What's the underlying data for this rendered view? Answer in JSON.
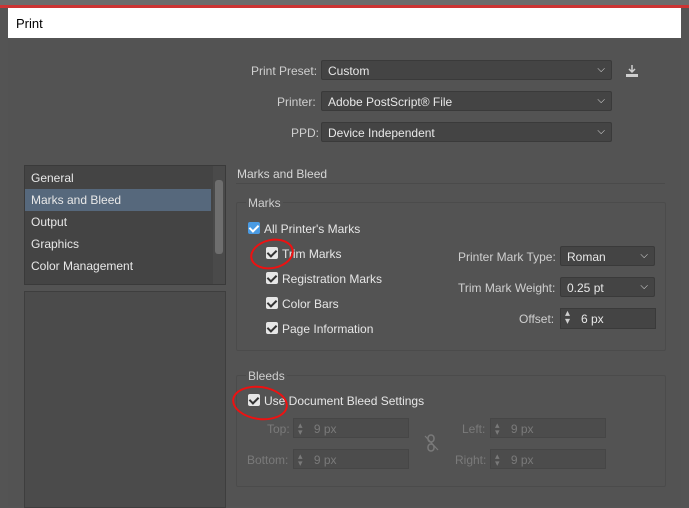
{
  "dialog": {
    "title": "Print"
  },
  "top": {
    "preset": {
      "label": "Print Preset:",
      "value": "Custom"
    },
    "printer": {
      "label": "Printer:",
      "value": "Adobe PostScript® File"
    },
    "ppd": {
      "label": "PPD:",
      "value": "Device Independent"
    }
  },
  "sidebar": {
    "items": [
      {
        "label": "General",
        "selected": false
      },
      {
        "label": "Marks and Bleed",
        "selected": true
      },
      {
        "label": "Output",
        "selected": false
      },
      {
        "label": "Graphics",
        "selected": false
      },
      {
        "label": "Color Management",
        "selected": false
      }
    ]
  },
  "section": {
    "title": "Marks and Bleed"
  },
  "marks": {
    "legend": "Marks",
    "all": "All Printer's Marks",
    "trim": "Trim Marks",
    "registration": "Registration Marks",
    "colorbars": "Color Bars",
    "pageinfo": "Page Information",
    "type_label": "Printer Mark Type:",
    "type_value": "Roman",
    "weight_label": "Trim Mark Weight:",
    "weight_value": "0.25 pt",
    "offset_label": "Offset:",
    "offset_value": "6 px"
  },
  "bleeds": {
    "legend": "Bleeds",
    "use_doc": "Use Document Bleed Settings",
    "top_label": "Top:",
    "top_value": "9 px",
    "bottom_label": "Bottom:",
    "bottom_value": "9 px",
    "left_label": "Left:",
    "left_value": "9 px",
    "right_label": "Right:",
    "right_value": "9 px"
  },
  "colors": {
    "accent": "#4a9be3",
    "selection": "#56687c",
    "annotation": "#e11111"
  }
}
